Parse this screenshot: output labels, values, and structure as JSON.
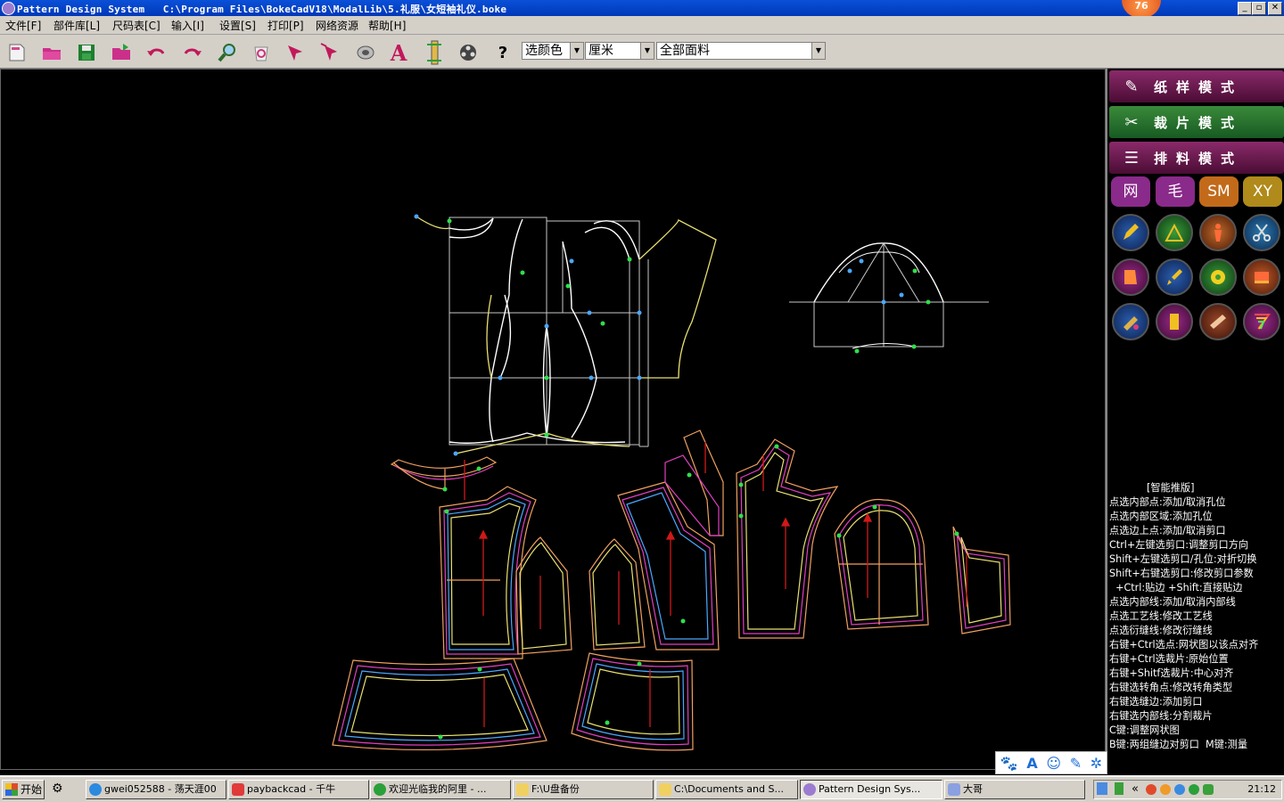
{
  "window": {
    "app_name": "Pattern Design System",
    "file_path": "C:\\Program Files\\BokeCadV18\\ModalLib\\5.礼服\\女短袖礼仪.boke",
    "badge_count": "76",
    "minimize": "_",
    "maximize": "▫",
    "close": "✕"
  },
  "menu": [
    "文件[F]",
    "部件库[L]",
    "尺码表[C]",
    "输入[I]",
    "设置[S]",
    "打印[P]",
    "网络资源",
    "帮助[H]"
  ],
  "toolbar": {
    "icons": [
      "new-page-icon",
      "open-folder-icon",
      "save-icon",
      "export-folder-icon",
      "undo-icon",
      "redo-icon",
      "zoom-icon",
      "delete-icon",
      "select-arrow-icon",
      "multi-select-icon",
      "measure-icon",
      "text-icon",
      "ruler-icon",
      "reel-icon",
      "help-icon"
    ],
    "help_label": "?",
    "text_label": "A",
    "color_select": "选颜色",
    "unit_select": "厘米",
    "fabric_select": "全部面料"
  },
  "modes": {
    "pattern_mode": "纸样模式",
    "cutting_mode": "裁片模式",
    "marker_mode": "排料模式"
  },
  "quick_buttons": [
    "网",
    "毛",
    "SM",
    "XY"
  ],
  "tool_icons": [
    "pencil-icon",
    "triangle-ruler-icon",
    "body-figure-icon",
    "scissors-icon",
    "pattern-piece-icon",
    "brush-icon",
    "tape-measure-icon",
    "sewing-machine-icon",
    "cut-tool-icon",
    "fabric-roll-icon",
    "cloth-piece-icon",
    "rainbow-line-icon"
  ],
  "help": {
    "title": "[智能推版]",
    "lines": [
      "点选内部点:添加/取消孔位",
      "点选内部区域:添加孔位",
      "点选边上点:添加/取消剪口",
      "Ctrl+左键选剪口:调整剪口方向",
      "Shift+左键选剪口/孔位:对折切换",
      "Shift+右键选剪口:修改剪口参数",
      "  +Ctrl:贴边 +Shift:直接贴边",
      "点选内部线:添加/取消内部线",
      "点选工艺线:修改工艺线",
      "点选衍缝线:修改衍缝线",
      "右键+Ctrl选点:网状图以该点对齐",
      "右键+Ctrl选裁片:原始位置",
      "右键+Shitf选裁片:中心对齐",
      "右键选转角点:修改转角类型",
      "右键选缝边:添加剪口",
      "右键选内部线:分割裁片",
      "C键:调整网状图",
      "B键:两组缝边对剪口  M键:测量"
    ]
  },
  "float_toolbar": [
    "paw-icon",
    "text-a-icon",
    "smile-icon",
    "pen-icon",
    "settings-icon"
  ],
  "taskbar": {
    "start": "开始",
    "tasks": [
      "gwei052588 - 荡天涯00",
      "paybackcad - 千牛",
      "欢迎光临我的阿里 - ...",
      "F:\\U盘备份",
      "C:\\Documents and S...",
      "Pattern Design Sys...",
      "大哥"
    ],
    "tray_chevron": "«",
    "clock": "21:12"
  },
  "colors": {
    "title_bar": "#0a50d8",
    "mode_button": "#6a1a4a",
    "mode_button_active": "#1e5a26",
    "canvas": "#000000",
    "seam_orange": "#f0a060",
    "grainline_red": "#d01818"
  }
}
